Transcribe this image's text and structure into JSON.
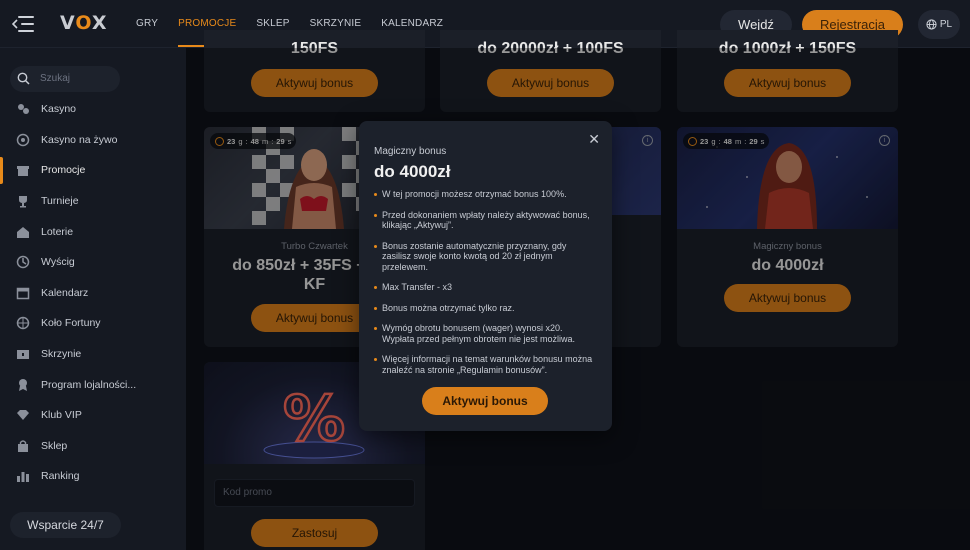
{
  "header": {
    "logo": "VOX",
    "nav": [
      "GRY",
      "PROMOCJE",
      "SKLEP",
      "SKRZYNIE",
      "KALENDARZ"
    ],
    "active_nav": "PROMOCJE",
    "login_label": "Wejdź",
    "register_label": "Rejestracja",
    "language": "PL"
  },
  "sidebar": {
    "search_placeholder": "Szukaj",
    "items": [
      {
        "label": "Kasyno",
        "icon": "cards-icon"
      },
      {
        "label": "Kasyno na żywo",
        "icon": "live-chip-icon"
      },
      {
        "label": "Promocje",
        "icon": "gift-icon"
      },
      {
        "label": "Turnieje",
        "icon": "trophy-icon"
      },
      {
        "label": "Loterie",
        "icon": "lottery-icon"
      },
      {
        "label": "Wyścig",
        "icon": "race-icon"
      },
      {
        "label": "Kalendarz",
        "icon": "calendar-icon"
      },
      {
        "label": "Koło Fortuny",
        "icon": "wheel-icon"
      },
      {
        "label": "Skrzynie",
        "icon": "chest-icon"
      },
      {
        "label": "Program lojalności...",
        "icon": "loyalty-icon"
      },
      {
        "label": "Klub VIP",
        "icon": "diamond-icon"
      },
      {
        "label": "Sklep",
        "icon": "bag-icon"
      },
      {
        "label": "Ranking",
        "icon": "ranking-icon"
      }
    ],
    "active_item": "Promocje",
    "support_label": "Wsparcie 24/7"
  },
  "cards_top": [
    {
      "title": "150FS",
      "button": "Aktywuj bonus"
    },
    {
      "title": "do 20000zł + 100FS",
      "button": "Aktywuj bonus"
    },
    {
      "title": "do 1000zł + 150FS",
      "button": "Aktywuj bonus"
    }
  ],
  "cards_middle": [
    {
      "timer": [
        "23",
        "g",
        "48",
        "m",
        "29",
        "s"
      ],
      "subtitle": "Turbo Czwartek",
      "title_line1": "do 850zł + 35FS + 2 ...",
      "title_line2": "KF",
      "button": "Aktywuj bonus"
    },
    {
      "subtitle": "...u",
      "button": ""
    },
    {
      "timer": [
        "23",
        "g",
        "48",
        "m",
        "29",
        "s"
      ],
      "subtitle": "Magiczny bonus",
      "title_line1": "do 4000zł",
      "button": "Aktywuj bonus"
    }
  ],
  "promo_card": {
    "input_placeholder": "Kod promo",
    "button": "Zastosuj"
  },
  "modal": {
    "subtitle": "Magiczny bonus",
    "title": "do 4000zł",
    "close": "✕",
    "bullets": [
      "W tej promocji możesz otrzymać bonus 100%.",
      "Przed dokonaniem wpłaty należy aktywować bonus, klikając „Aktywuj”.",
      "Bonus zostanie automatycznie przyznany, gdy zasilisz swoje konto kwotą od 20 zł jednym przelewem.",
      "Max Transfer - x3",
      "Bonus można otrzymać tylko raz.",
      "Wymóg obrotu bonusem (wager) wynosi x20. Wypłata przed pełnym obrotem nie jest możliwa.",
      "Więcej informacji na temat warunków bonusu można znaleźć na stronie „Regulamin bonusów”."
    ],
    "button": "Aktywuj bonus"
  },
  "colors": {
    "accent": "#d97f1b",
    "background": "#0f1219",
    "panel": "#1b1f28"
  }
}
